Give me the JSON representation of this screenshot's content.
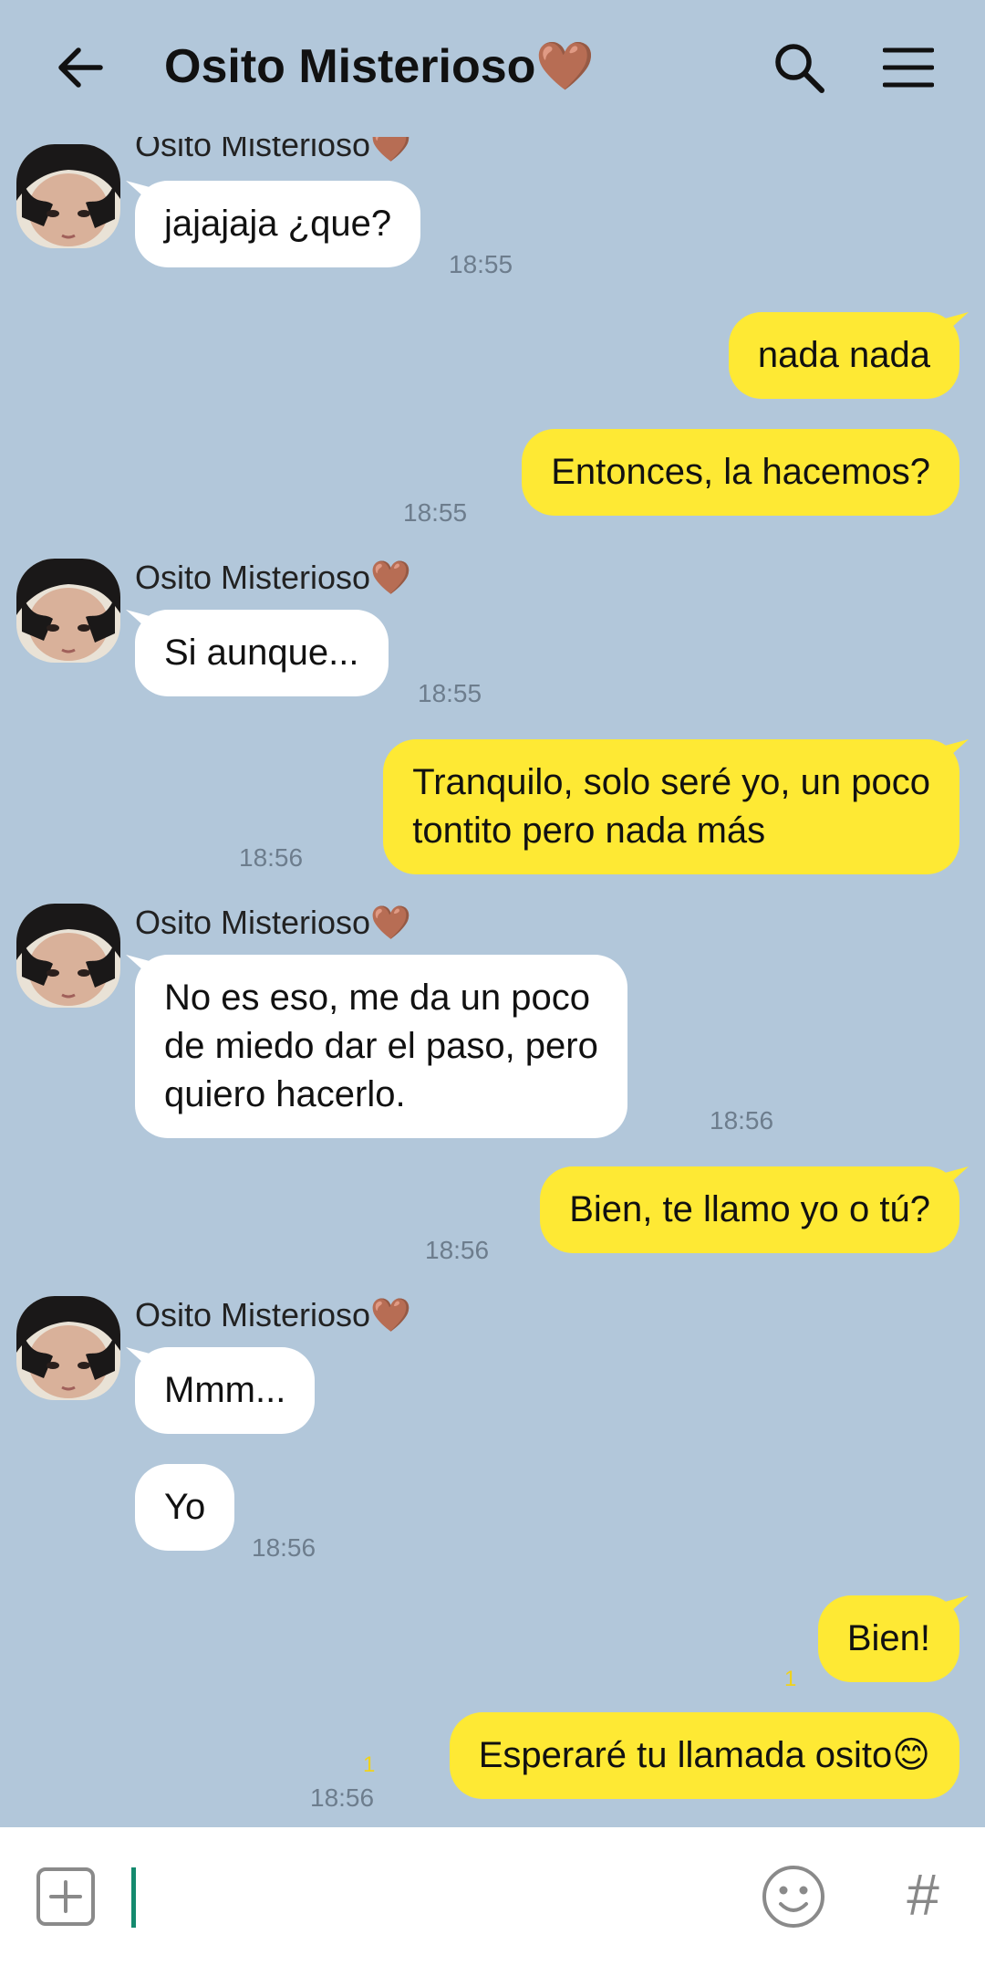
{
  "header": {
    "title": "Osito Misterioso🤎",
    "back_icon": "arrow-left-icon",
    "search_icon": "search-icon",
    "menu_icon": "hamburger-menu-icon"
  },
  "messages": [
    {
      "sender_name": "Osito Misterioso🤎",
      "text": "jajajaja ¿que?",
      "time": "18:55"
    },
    {
      "text": "nada nada"
    },
    {
      "text": "Entonces, la hacemos?",
      "time": "18:55"
    },
    {
      "sender_name": "Osito Misterioso🤎",
      "text": "Si aunque...",
      "time": "18:55"
    },
    {
      "text": "Tranquilo, solo seré yo, un poco\ntontito pero nada más",
      "time": "18:56"
    },
    {
      "sender_name": "Osito Misterioso🤎",
      "text": "No es eso, me da un poco\nde miedo dar el paso, pero\nquiero hacerlo.",
      "time": "18:56"
    },
    {
      "text": "Bien, te llamo yo o tú?",
      "time": "18:56"
    },
    {
      "sender_name": "Osito Misterioso🤎",
      "text": "Mmm..."
    },
    {
      "text": "Yo",
      "time": "18:56"
    },
    {
      "text": "Bien!",
      "unread": "1"
    },
    {
      "text": "Esperaré tu llamada osito😊",
      "time": "18:56",
      "unread": "1"
    }
  ],
  "composer": {
    "value": "",
    "plus_icon": "plus-square-icon",
    "emoji_icon": "emoji-smile-icon",
    "hash_label": "#"
  },
  "colors": {
    "background": "#b2c7da",
    "incoming_bubble": "#ffffff",
    "outgoing_bubble": "#fee934",
    "cursor": "#148a6e"
  }
}
